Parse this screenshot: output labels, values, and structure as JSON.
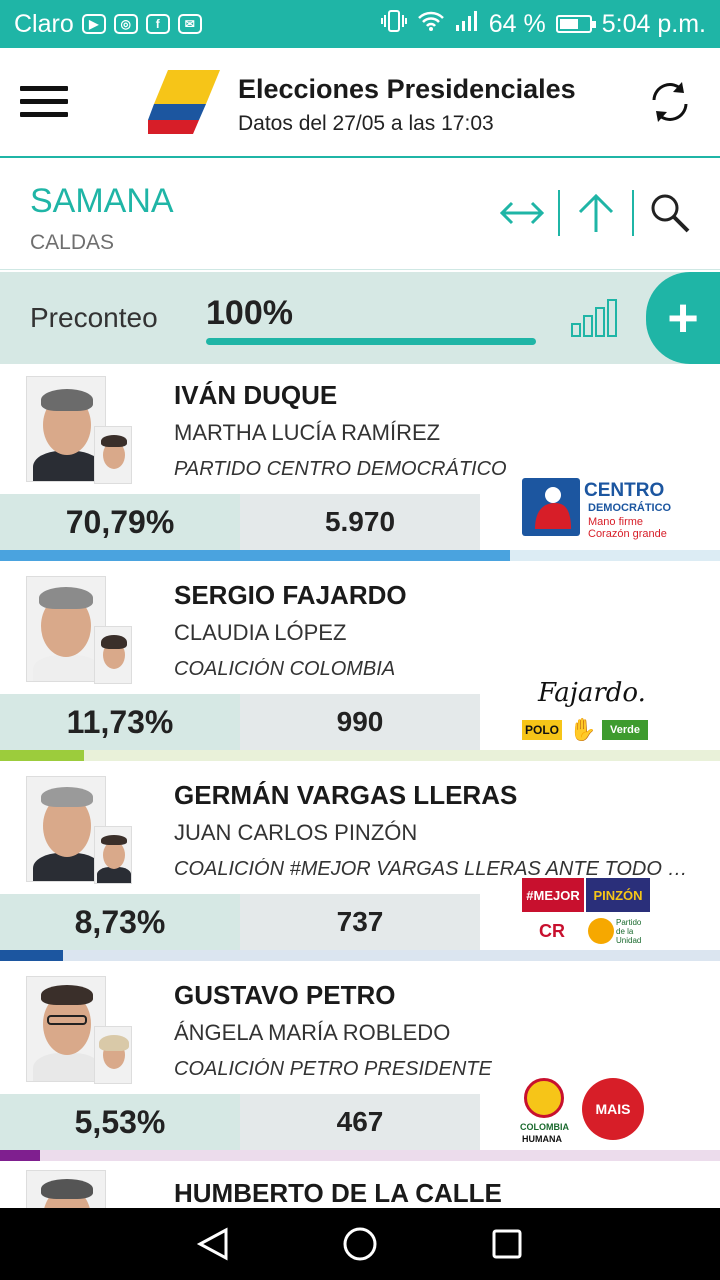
{
  "status_bar": {
    "carrier": "Claro",
    "battery": "64 %",
    "battery_level": 0.64,
    "time": "5:04 p.m.",
    "icons": [
      "youtube-icon",
      "instagram-icon",
      "facebook-icon",
      "mail-icon",
      "vibrate-icon",
      "wifi-icon",
      "signal-icon",
      "battery-icon"
    ]
  },
  "header": {
    "title": "Elecciones Presidenciales",
    "subtitle": "Datos del 27/05 a las 17:03",
    "icons": [
      "menu-icon",
      "flag-logo",
      "refresh-icon"
    ]
  },
  "location": {
    "municipality": "SAMANA",
    "department": "CALDAS",
    "icons": [
      "expand-horizontal-icon",
      "arrow-up-icon",
      "search-icon"
    ]
  },
  "preconteo": {
    "label": "Preconteo",
    "value": "100%",
    "progress": 1.0,
    "icons": [
      "bar-chart-icon",
      "plus-icon"
    ]
  },
  "candidates": [
    {
      "name": "IVÁN DUQUE",
      "vice": "MARTHA LUCÍA RAMÍREZ",
      "party": "PARTIDO CENTRO DEMOCRÁTICO",
      "percent": "70,79%",
      "votes": "5.970",
      "share": 0.7079,
      "bar_color": "#4aa3df",
      "track_color": "#dcecf4",
      "logo": {
        "line1": "CENTRO",
        "line2": "DEMOCRÁTICO",
        "line3": "Mano firme",
        "line4": "Corazón grande"
      }
    },
    {
      "name": "SERGIO FAJARDO",
      "vice": "CLAUDIA LÓPEZ",
      "party": "COALICIÓN COLOMBIA",
      "percent": "11,73%",
      "votes": "990",
      "share": 0.1173,
      "bar_color": "#9ccc3c",
      "track_color": "#e9f1d9",
      "logo": {
        "line1": "Fajardo.",
        "line2": "POLO",
        "line3": "Verde"
      }
    },
    {
      "name": "GERMÁN VARGAS LLERAS",
      "vice": "JUAN CARLOS PINZÓN",
      "party": "COALICIÓN #MEJOR VARGAS LLERAS ANTE TODO C...",
      "percent": "8,73%",
      "votes": "737",
      "share": 0.0873,
      "bar_color": "#1c56a0",
      "track_color": "#dbe5f0",
      "logo": {
        "line1": "#MEJOR",
        "line2": "PINZÓN",
        "line3": "CR",
        "line4": "Partido de la Unidad"
      }
    },
    {
      "name": "GUSTAVO PETRO",
      "vice": "ÁNGELA MARÍA ROBLEDO",
      "party": "COALICIÓN PETRO PRESIDENTE",
      "percent": "5,53%",
      "votes": "467",
      "share": 0.0553,
      "bar_color": "#7f1f8f",
      "track_color": "#ecdcec",
      "logo": {
        "line1": "COLOMBIA",
        "line2": "HUMANA",
        "line3": "MAIS"
      }
    },
    {
      "name": "HUMBERTO DE LA CALLE"
    }
  ],
  "nav": {
    "icons": [
      "back-icon",
      "home-icon",
      "recents-icon"
    ]
  }
}
